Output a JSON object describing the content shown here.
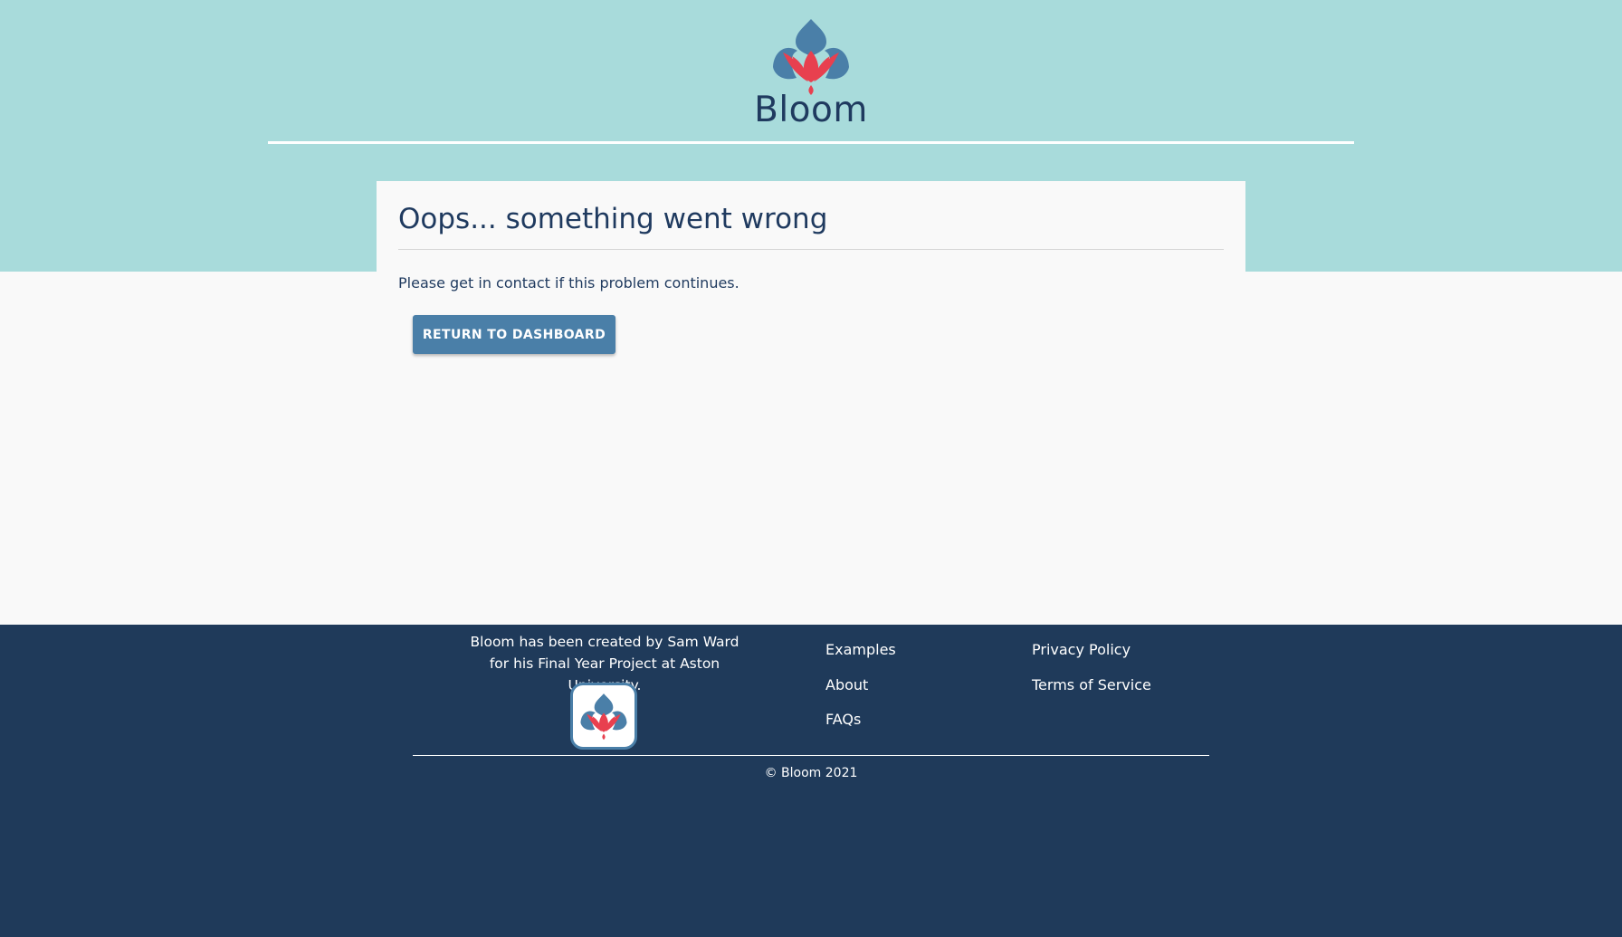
{
  "brand": {
    "name": "Bloom",
    "logo_icon": "lotus-icon",
    "colors": {
      "header_bg": "#a8dbdb",
      "page_bg": "#f9f9f9",
      "primary_text": "#1f3a5f",
      "button_bg": "#4a7fa8",
      "footer_bg": "#1f3a5a",
      "lotus_red": "#e8404f",
      "lotus_blue": "#4a7fa8"
    }
  },
  "error_card": {
    "title": "Oops... something went wrong",
    "message": "Please get in contact if this problem continues.",
    "button_label": "RETURN TO DASHBOARD"
  },
  "footer": {
    "credit": "Bloom has been created by Sam Ward for his Final Year Project at Aston University.",
    "app_icon": "lotus-app-icon",
    "links_col1": [
      "Examples",
      "About",
      "FAQs"
    ],
    "links_col2": [
      "Privacy Policy",
      "Terms of Service"
    ],
    "copyright": "© Bloom 2021"
  }
}
